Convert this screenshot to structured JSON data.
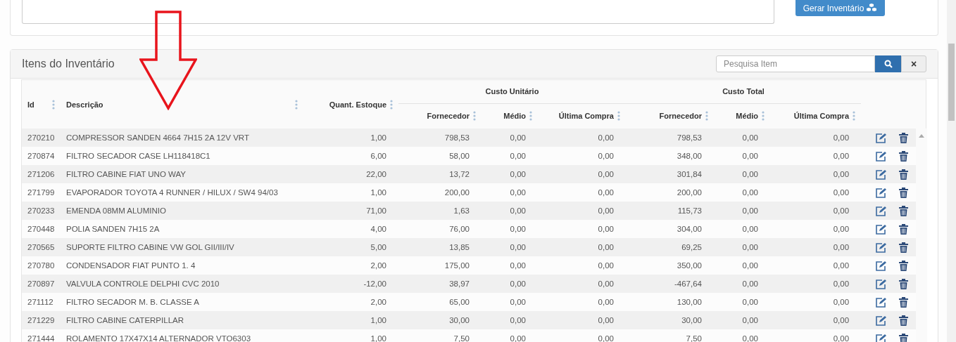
{
  "top_panel": {
    "generate_button": "Gerar Inventário"
  },
  "items_panel": {
    "title": "Itens do Inventário",
    "search": {
      "placeholder": "Pesquisa Item"
    },
    "clear_button": "×"
  },
  "table": {
    "columns": [
      {
        "label": "Id"
      },
      {
        "label": "Descrição"
      },
      {
        "label": "Quant. Estoque"
      }
    ],
    "groups": [
      {
        "label": "Custo Unitário",
        "columns": [
          "Fornecedor",
          "Médio",
          "Última Compra"
        ]
      },
      {
        "label": "Custo Total",
        "columns": [
          "Fornecedor",
          "Médio",
          "Última Compra"
        ]
      }
    ],
    "rows": [
      {
        "id": "270210",
        "description": "COMPRESSOR SANDEN 4664 7H15 2A 12V VRT",
        "quantity": "1,00",
        "values": [
          "798,53",
          "0,00",
          "0,00",
          "798,53",
          "0,00",
          "0,00"
        ]
      },
      {
        "id": "270874",
        "description": "FILTRO SECADOR CASE LH118418C1",
        "quantity": "6,00",
        "values": [
          "58,00",
          "0,00",
          "0,00",
          "348,00",
          "0,00",
          "0,00"
        ]
      },
      {
        "id": "271206",
        "description": "FILTRO CABINE FIAT UNO WAY",
        "quantity": "22,00",
        "values": [
          "13,72",
          "0,00",
          "0,00",
          "301,84",
          "0,00",
          "0,00"
        ]
      },
      {
        "id": "271799",
        "description": "EVAPORADOR TOYOTA 4 RUNNER / HILUX / SW4 94/03",
        "quantity": "1,00",
        "values": [
          "200,00",
          "0,00",
          "0,00",
          "200,00",
          "0,00",
          "0,00"
        ]
      },
      {
        "id": "270233",
        "description": "EMENDA 08MM ALUMINIO",
        "quantity": "71,00",
        "values": [
          "1,63",
          "0,00",
          "0,00",
          "115,73",
          "0,00",
          "0,00"
        ]
      },
      {
        "id": "270448",
        "description": "POLIA SANDEN 7H15 2A",
        "quantity": "4,00",
        "values": [
          "76,00",
          "0,00",
          "0,00",
          "304,00",
          "0,00",
          "0,00"
        ]
      },
      {
        "id": "270565",
        "description": "SUPORTE FILTRO CABINE VW GOL GII/III/IV",
        "quantity": "5,00",
        "values": [
          "13,85",
          "0,00",
          "0,00",
          "69,25",
          "0,00",
          "0,00"
        ]
      },
      {
        "id": "270780",
        "description": "CONDENSADOR FIAT PUNTO 1. 4",
        "quantity": "2,00",
        "values": [
          "175,00",
          "0,00",
          "0,00",
          "350,00",
          "0,00",
          "0,00"
        ]
      },
      {
        "id": "270897",
        "description": "VALVULA CONTROLE DELPHI CVC 2010",
        "quantity": "-12,00",
        "values": [
          "38,97",
          "0,00",
          "0,00",
          "-467,64",
          "0,00",
          "0,00"
        ]
      },
      {
        "id": "271112",
        "description": "FILTRO SECADOR M. B. CLASSE A",
        "quantity": "2,00",
        "values": [
          "65,00",
          "0,00",
          "0,00",
          "130,00",
          "0,00",
          "0,00"
        ]
      },
      {
        "id": "271229",
        "description": "FILTRO CABINE CATERPILLAR",
        "quantity": "1,00",
        "values": [
          "30,00",
          "0,00",
          "0,00",
          "30,00",
          "0,00",
          "0,00"
        ]
      },
      {
        "id": "271444",
        "description": "ROLAMENTO 17X47X14 ALTERNADOR VTO6303",
        "quantity": "1,00",
        "values": [
          "7,50",
          "0,00",
          "0,00",
          "7,50",
          "0,00",
          "0,00"
        ]
      }
    ]
  }
}
